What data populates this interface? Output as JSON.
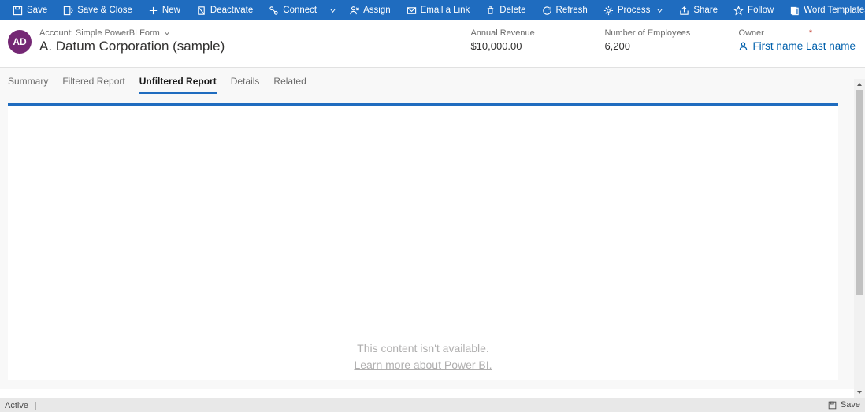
{
  "commands": {
    "save": "Save",
    "save_close": "Save & Close",
    "new": "New",
    "deactivate": "Deactivate",
    "connect": "Connect",
    "assign": "Assign",
    "email_link": "Email a Link",
    "delete": "Delete",
    "refresh": "Refresh",
    "process": "Process",
    "share": "Share",
    "follow": "Follow",
    "word_templates": "Word Templates"
  },
  "header": {
    "avatar_initials": "AD",
    "form_label": "Account: Simple PowerBI Form",
    "record_name": "A. Datum Corporation (sample)",
    "fields": {
      "annual_revenue_label": "Annual Revenue",
      "annual_revenue_value": "$10,000.00",
      "num_employees_label": "Number of Employees",
      "num_employees_value": "6,200",
      "owner_label": "Owner",
      "owner_value": "First name Last name"
    }
  },
  "tabs": {
    "summary": "Summary",
    "filtered": "Filtered Report",
    "unfiltered": "Unfiltered Report",
    "details": "Details",
    "related": "Related"
  },
  "empty": {
    "line1": "This content isn't available.",
    "link": "Learn more about Power BI."
  },
  "status": {
    "state": "Active",
    "save": "Save"
  }
}
